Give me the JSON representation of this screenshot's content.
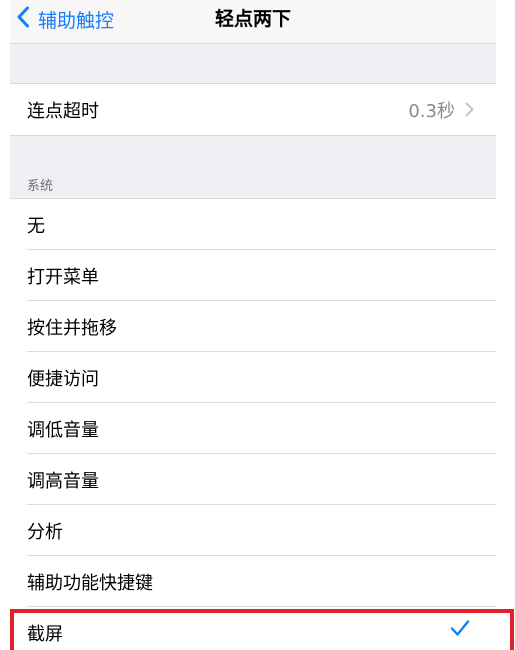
{
  "nav": {
    "back_label": "辅助触控",
    "title": "轻点两下"
  },
  "timeout": {
    "label": "连点超时",
    "value": "0.3秒"
  },
  "system": {
    "header": "系统",
    "items": [
      {
        "label": "无"
      },
      {
        "label": "打开菜单"
      },
      {
        "label": "按住并拖移"
      },
      {
        "label": "便捷访问"
      },
      {
        "label": "调低音量"
      },
      {
        "label": "调高音量"
      },
      {
        "label": "分析"
      },
      {
        "label": "辅助功能快捷键"
      },
      {
        "label": "截屏",
        "selected": true
      }
    ]
  },
  "colors": {
    "accent": "#147efb",
    "highlight_border": "#e0202a"
  },
  "icons": {
    "back": "chevron-left-icon",
    "disclosure": "chevron-right-icon",
    "selected": "checkmark-icon"
  }
}
